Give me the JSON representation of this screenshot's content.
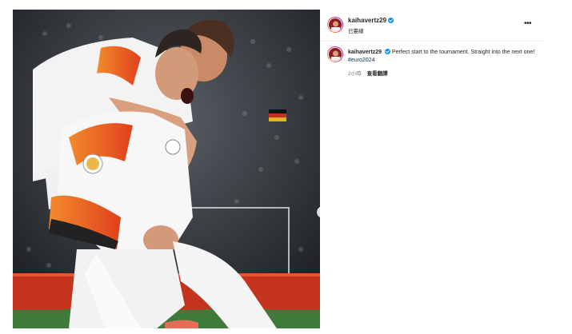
{
  "post": {
    "username": "kaihavertz29",
    "location": "已婁線",
    "caption": {
      "username": "kaihavertz29",
      "text": "Perfect start to the tournament. Straight into the next one!",
      "hashtag": "#euro2024"
    },
    "time_ago": "2小時",
    "translate_label": "查看翻譯",
    "more_label": "•••"
  },
  "colors": {
    "verified": "#0095f6",
    "hashtag": "#00376b",
    "secondary_text": "#737373"
  },
  "icons": [
    "verified-badge-icon",
    "more-options-icon",
    "next-image-arrow-icon"
  ]
}
